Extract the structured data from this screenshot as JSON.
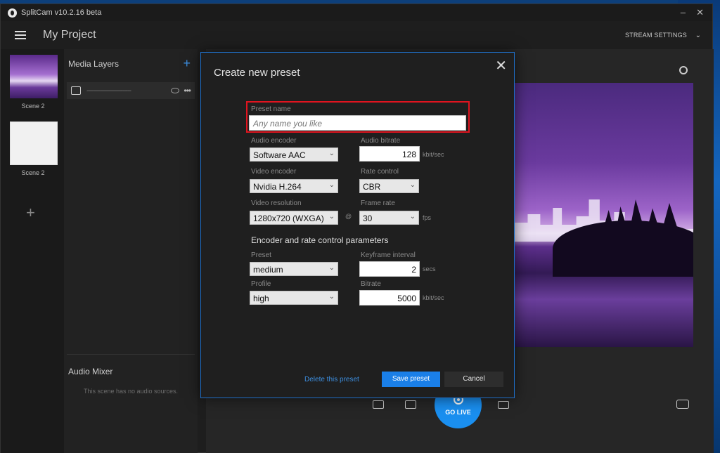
{
  "window": {
    "title": "SplitCam v10.2.16 beta",
    "minimize": "–",
    "close": "✕"
  },
  "header": {
    "project_title": "My Project",
    "stream_settings": "STREAM SETTINGS",
    "chevron": "⌄"
  },
  "scenes": {
    "items": [
      {
        "label": "Scene 2"
      },
      {
        "label": "Scene 2"
      }
    ],
    "add": "+"
  },
  "layers": {
    "title": "Media Layers",
    "add": "+",
    "item_name": "---------------------------",
    "dots": "•••"
  },
  "audio_mixer": {
    "title": "Audio Mixer",
    "empty_text": "This scene has no audio sources."
  },
  "go_live": {
    "label": "GO LIVE"
  },
  "dialog": {
    "title": "Create new preset",
    "close": "✕",
    "preset_name": {
      "label": "Preset name",
      "placeholder": "Any name you like"
    },
    "audio_encoder": {
      "label": "Audio encoder",
      "value": "Software AAC"
    },
    "audio_bitrate": {
      "label": "Audio bitrate",
      "value": "128",
      "unit": "kbit/sec"
    },
    "video_encoder": {
      "label": "Video encoder",
      "value": "Nvidia H.264"
    },
    "rate_control": {
      "label": "Rate control",
      "value": "CBR"
    },
    "video_resolution": {
      "label": "Video resolution",
      "value": "1280x720 (WXGA)"
    },
    "at": "@",
    "frame_rate": {
      "label": "Frame rate",
      "value": "30",
      "unit": "fps"
    },
    "section_title": "Encoder and rate control parameters",
    "preset": {
      "label": "Preset",
      "value": "medium"
    },
    "keyframe_interval": {
      "label": "Keyframe interval",
      "value": "2",
      "unit": "secs"
    },
    "profile": {
      "label": "Profile",
      "value": "high"
    },
    "bitrate": {
      "label": "Bitrate",
      "value": "5000",
      "unit": "kbit/sec"
    },
    "delete_label": "Delete this preset",
    "save_label": "Save preset",
    "cancel_label": "Cancel",
    "chevron": "⌄"
  },
  "colors": {
    "accent": "#1a7fe8",
    "highlight": "#e0141f"
  }
}
